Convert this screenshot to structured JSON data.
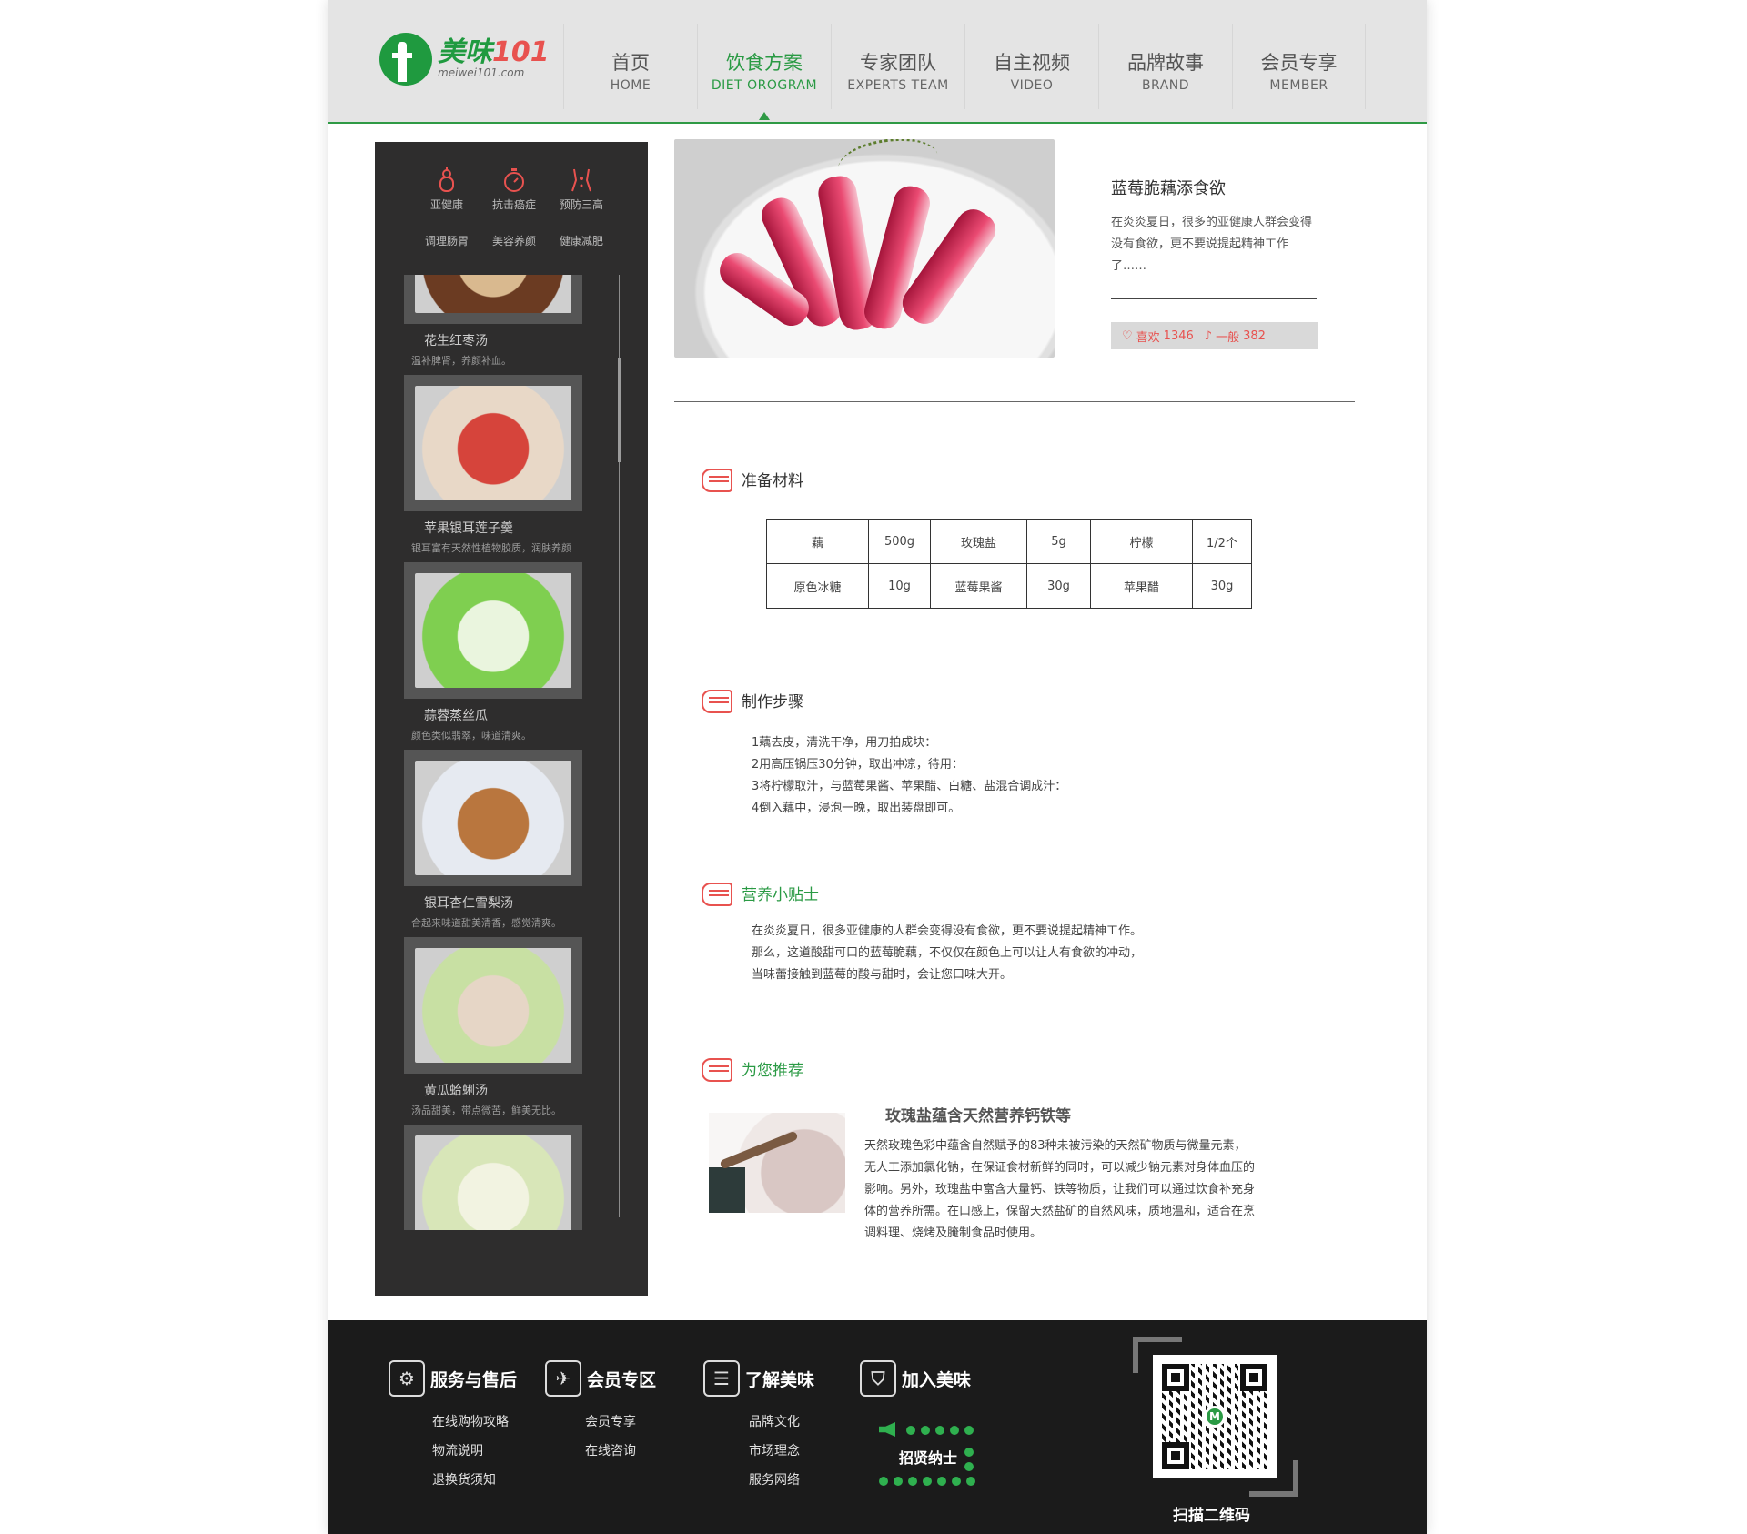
{
  "logo": {
    "title_cn": "美味",
    "title_num": "101",
    "sub": "meiwei101.com"
  },
  "nav": [
    {
      "cn": "首页",
      "en": "HOME"
    },
    {
      "cn": "饮食方案",
      "en": "DIET OROGRAM"
    },
    {
      "cn": "专家团队",
      "en": "EXPERTS TEAM"
    },
    {
      "cn": "自主视频",
      "en": "VIDEO"
    },
    {
      "cn": "品牌故事",
      "en": "BRAND"
    },
    {
      "cn": "会员专享",
      "en": "MEMBER"
    }
  ],
  "categories": {
    "row1": [
      {
        "label": "亚健康",
        "icon": "gourd-icon"
      },
      {
        "label": "抗击癌症",
        "icon": "timer-icon"
      },
      {
        "label": "预防三高",
        "icon": "sparkle-icon"
      }
    ],
    "row2": [
      "调理肠胃",
      "美容养颜",
      "健康减肥"
    ]
  },
  "recipes": [
    {
      "title": "花生红枣汤",
      "desc": "温补脾肾，养颜补血。",
      "colors": [
        "#6b3b22",
        "#d9b98f"
      ]
    },
    {
      "title": "苹果银耳莲子羹",
      "desc": "银耳富有天然性植物胶质，润肤养颜",
      "colors": [
        "#e8d8c7",
        "#d6443b"
      ]
    },
    {
      "title": "蒜蓉蒸丝瓜",
      "desc": "颜色类似翡翠，味道清爽。",
      "colors": [
        "#7fcf50",
        "#eaf5de"
      ]
    },
    {
      "title": "银耳杏仁雪梨汤",
      "desc": "合起来味道甜美清香，感觉清爽。",
      "colors": [
        "#e6eaf1",
        "#b9763e"
      ]
    },
    {
      "title": "黄瓜蛤蜊汤",
      "desc": "汤品甜美，带点微苦，鲜美无比。",
      "colors": [
        "#c8e0a3",
        "#e6d6c6"
      ]
    },
    {
      "title": "",
      "desc": "",
      "colors": [
        "#d8e6b8",
        "#f2f3e1"
      ]
    }
  ],
  "hero": {
    "title": "蓝莓脆藕添食欲",
    "desc": "在炎炎夏日，很多的亚健康人群会变得没有食欲，更不要说提起精神工作了……",
    "like_label": "喜欢",
    "like_count": "1346",
    "normal_label": "一般",
    "normal_count": "382"
  },
  "sections": {
    "ingredients": "准备材料",
    "steps": "制作步骤",
    "tips": "营养小贴士",
    "recommend": "为您推荐"
  },
  "ingredients": [
    [
      "藕",
      "500g",
      "玫瑰盐",
      "5g",
      "柠檬",
      "1/2个"
    ],
    [
      "原色冰糖",
      "10g",
      "蓝莓果酱",
      "30g",
      "苹果醋",
      "30g"
    ]
  ],
  "steps": [
    "1藕去皮，清洗干净，用刀拍成块：",
    "2用高压锅压30分钟，取出冲凉，待用：",
    "3将柠檬取汁，与蓝莓果酱、苹果醋、白糖、盐混合调成汁：",
    "4倒入藕中，浸泡一晚，取出装盘即可。"
  ],
  "tips": [
    "在炎炎夏日，很多亚健康的人群会变得没有食欲，更不要说提起精神工作。",
    "那么，这道酸甜可口的蓝莓脆藕，不仅仅在颜色上可以让人有食欲的冲动，",
    "当味蕾接触到蓝莓的酸与甜时，会让您口味大开。"
  ],
  "recommend": {
    "title": "玫瑰盐蕴含天然营养钙铁等",
    "desc": "天然玫瑰色彩中蕴含自然赋予的83种未被污染的天然矿物质与微量元素，无人工添加氯化钠，在保证食材新鲜的同时，可以减少钠元素对身体血压的影响。另外，玫瑰盐中富含大量钙、铁等物质，让我们可以通过饮食补充身体的营养所需。在口感上，保留天然盐矿的自然风味，质地温和，适合在烹调料理、烧烤及腌制食品时使用。"
  },
  "footer": {
    "cols": [
      {
        "title": "服务与售后",
        "icon": "gear-icon",
        "glyph": "⚙",
        "links": [
          "在线购物攻略",
          "物流说明",
          "退换货须知"
        ]
      },
      {
        "title": "会员专区",
        "icon": "paper-plane-icon",
        "glyph": "✈",
        "links": [
          "会员专享",
          "在线咨询"
        ]
      },
      {
        "title": "了解美味",
        "icon": "coins-icon",
        "glyph": "☰",
        "links": [
          "品牌文化",
          "市场理念",
          "服务网络"
        ]
      },
      {
        "title": "加入美味",
        "icon": "shopping-bag-icon",
        "glyph": "⛉",
        "links": []
      }
    ],
    "join_badge": "招贤纳士",
    "qr_caption": "扫描二维码",
    "qr_logo": "M"
  },
  "colors": {
    "brand_green": "#2a9a44",
    "accent_red": "#e8524f",
    "sidebar_bg": "#2e2d2d",
    "footer_bg": "#1b1b1b"
  }
}
